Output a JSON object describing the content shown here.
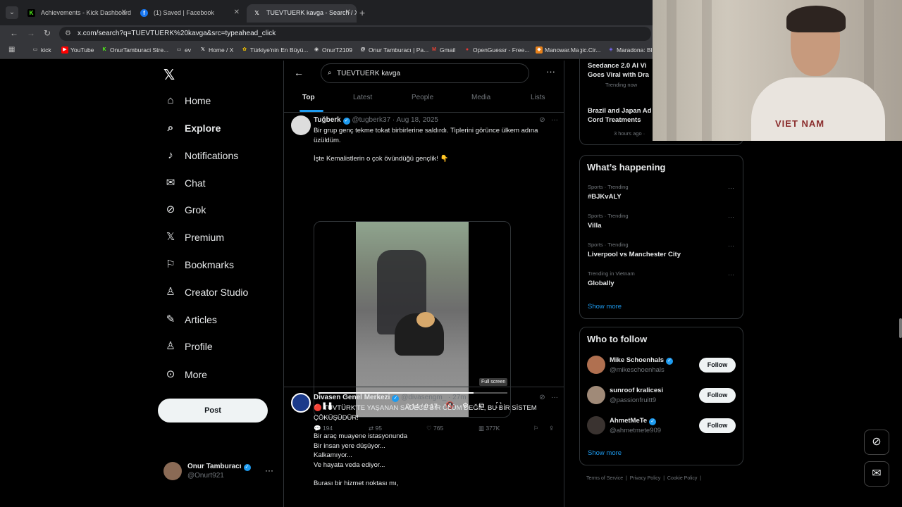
{
  "browser": {
    "tabs": [
      {
        "title": "Achievements - Kick Dashboard",
        "icon": "kick-icon",
        "color": "#53fc18"
      },
      {
        "title": "(1) Saved | Facebook",
        "icon": "facebook-icon",
        "color": "#1877f2"
      },
      {
        "title": "TUEVTUERK kavga - Search / X",
        "icon": "x-icon",
        "color": "#ffffff"
      }
    ],
    "url": "x.com/search?q=TUEVTUERK%20kavga&src=typeahead_click",
    "bookmarks": [
      "kick",
      "YouTube",
      "OnurTamburaci Stre...",
      "ev",
      "Home / X",
      "Türkiye'nin En Büyü...",
      "OnurT2109",
      "Onur Tamburacı | Pa...",
      "Gmail",
      "OpenGuessr - Free...",
      "Manowar.Magic.Cir...",
      "Maradona: Bl"
    ]
  },
  "nav": {
    "items": [
      {
        "label": "Home",
        "icon": "home-icon"
      },
      {
        "label": "Explore",
        "icon": "search-icon"
      },
      {
        "label": "Notifications",
        "icon": "bell-icon"
      },
      {
        "label": "Chat",
        "icon": "mail-icon"
      },
      {
        "label": "Grok",
        "icon": "grok-icon"
      },
      {
        "label": "Premium",
        "icon": "x-icon"
      },
      {
        "label": "Bookmarks",
        "icon": "bookmark-icon"
      },
      {
        "label": "Creator Studio",
        "icon": "flask-icon"
      },
      {
        "label": "Articles",
        "icon": "article-icon"
      },
      {
        "label": "Profile",
        "icon": "person-icon"
      },
      {
        "label": "More",
        "icon": "more-circle-icon"
      }
    ],
    "post_label": "Post",
    "user": {
      "name": "Onur Tamburacı",
      "handle": "@Onurt921"
    }
  },
  "search": {
    "query": "TUEVTUERK kavga",
    "tabs": [
      "Top",
      "Latest",
      "People",
      "Media",
      "Lists"
    ],
    "active_tab": "Top"
  },
  "tweets": [
    {
      "name": "Tuğberk",
      "handle": "@tugberk37",
      "date": "· Aug 18, 2025",
      "text1": "Bir grup genç tekme tokat birbirlerine saldırdı. Tiplerini görünce ülkem adına üzüldüm.",
      "text2": "İşte Kemalistlerin o çok övündüğü gençlik! 👇",
      "video": {
        "time": "0:14 / 0:17",
        "progress": 0.82,
        "tooltip": "Full screen"
      },
      "replies": "194",
      "reposts": "95",
      "likes": "765",
      "views": "377K"
    },
    {
      "name": "Divasen Genel Merkezi",
      "handle": "@divasengm_",
      "date": "· 27m",
      "headline": "🔴 TÜVTÜRK'TE YAŞANAN SADECE BİR ÖLÜM DEĞİL, BU BİR SİSTEM ÇÖKÜŞÜDÜR!",
      "lines": [
        "Bir araç muayene istasyonunda",
        "Bir insan yere düşüyor...",
        "Kalkamıyor...",
        "Ve hayata veda ediyor..."
      ],
      "last_line": "Burası bir hizmet noktası mı,"
    }
  ],
  "news": [
    {
      "title_line1": "Seedance 2.0 AI Vi",
      "title_line2": "Goes Viral with Dra",
      "meta": "Trending now"
    },
    {
      "title_line1": "Brazil and Japan Ad",
      "title_line2": "Cord Treatments",
      "meta": "3 hours ago ·"
    }
  ],
  "happening": {
    "title": "What’s happening",
    "trends": [
      {
        "context": "Sports · Trending",
        "name": "#BJKvALY"
      },
      {
        "context": "Sports · Trending",
        "name": "Villa"
      },
      {
        "context": "Sports · Trending",
        "name": "Liverpool vs Manchester City"
      },
      {
        "context": "Trending in Vietnam",
        "name": "Globally"
      }
    ],
    "show_more": "Show more"
  },
  "who_to_follow": {
    "title": "Who to follow",
    "users": [
      {
        "name": "Mike Schoenhals",
        "handle": "@mikeschoenhals",
        "verified": true
      },
      {
        "name": "sunroof kralicesi",
        "handle": "@passionfruitt9",
        "verified": false
      },
      {
        "name": "AhmetMeTe",
        "handle": "@ahmetmete909",
        "verified": true
      }
    ],
    "follow_label": "Follow",
    "show_more": "Show more"
  },
  "footer": [
    "Terms of Service",
    "Privacy Policy",
    "Cookie Policy"
  ],
  "webcam": {
    "shirt_text": "VIET NAM"
  },
  "colors": {
    "accent": "#1d9bf0",
    "background": "#000000",
    "border": "#2f3336",
    "muted": "#71767b"
  }
}
